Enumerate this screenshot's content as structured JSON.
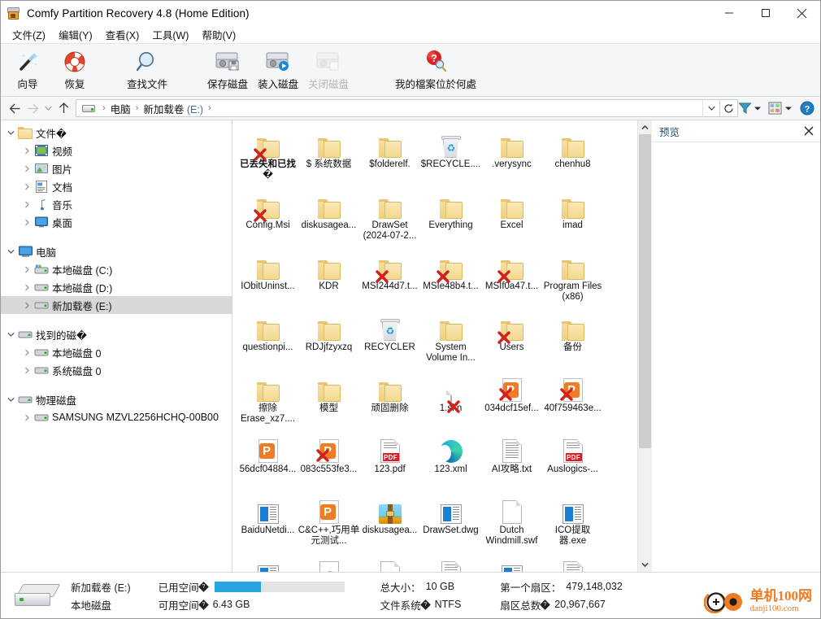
{
  "window": {
    "title": "Comfy Partition Recovery 4.8 (Home Edition)",
    "icon": "app-icon",
    "minimize": "—",
    "maximize": "☐",
    "close": "×"
  },
  "menubar": [
    {
      "label": "文件(Z)"
    },
    {
      "label": "编辑(Y)"
    },
    {
      "label": "查看(X)"
    },
    {
      "label": "工具(W)"
    },
    {
      "label": "帮助(V)"
    }
  ],
  "toolbar": [
    {
      "label": "向导",
      "icon": "wand-icon",
      "disabled": false
    },
    {
      "label": "恢复",
      "icon": "lifebuoy-icon",
      "disabled": false
    },
    {
      "label": "查找文件",
      "icon": "magnifier-icon",
      "disabled": false
    },
    {
      "label": "保存磁盘",
      "icon": "save-disk-icon",
      "disabled": false
    },
    {
      "label": "装入磁盘",
      "icon": "load-disk-icon",
      "disabled": false
    },
    {
      "label": "关闭磁盘",
      "icon": "close-disk-icon",
      "disabled": true
    },
    {
      "label": "我的檔案位於何處",
      "icon": "help-search-icon",
      "disabled": false
    }
  ],
  "addressbar": {
    "back": "←",
    "forward": "→",
    "history": "⌄",
    "up": "↑",
    "crumbs": [
      "电脑",
      "新加载卷 (E:)"
    ],
    "crumb_drive_suffix": "(E:)",
    "crumb_drive_name": "新加载卷",
    "dropdown": "⌄",
    "refresh": "↻",
    "filter_icon": "filter-icon",
    "view_icon": "view-mode-icon",
    "help_icon": "help-icon"
  },
  "tree": {
    "groups": [
      {
        "root": {
          "label": "文件�",
          "icon": "folder-icon",
          "expanded": true
        },
        "children": [
          {
            "label": "视频",
            "icon": "video-icon"
          },
          {
            "label": "图片",
            "icon": "pictures-icon"
          },
          {
            "label": "文档",
            "icon": "documents-icon"
          },
          {
            "label": "音乐",
            "icon": "music-icon"
          },
          {
            "label": "桌面",
            "icon": "desktop-icon"
          }
        ]
      },
      {
        "root": {
          "label": "电脑",
          "icon": "computer-icon",
          "expanded": true
        },
        "children": [
          {
            "label": "本地磁盘 (C:)",
            "icon": "system-drive-icon"
          },
          {
            "label": "本地磁盘 (D:)",
            "icon": "drive-icon"
          },
          {
            "label": "新加载卷 (E:)",
            "icon": "drive-icon",
            "selected": true
          }
        ]
      },
      {
        "root": {
          "label": "找到的磁�",
          "icon": "drive-icon",
          "expanded": true
        },
        "children": [
          {
            "label": "本地磁盘 0",
            "icon": "drive-icon"
          },
          {
            "label": "系统磁盘 0",
            "icon": "drive-icon"
          }
        ]
      },
      {
        "root": {
          "label": "物理磁盘",
          "icon": "drive-icon",
          "expanded": true
        },
        "children": [
          {
            "label": "SAMSUNG MZVL2256HCHQ-00B00",
            "icon": "drive-icon"
          }
        ]
      }
    ]
  },
  "files": [
    {
      "name": "已丢失和已找�",
      "icon": "folder-deleted-icon",
      "bold": true
    },
    {
      "name": "$ 系统数据",
      "icon": "folder-icon"
    },
    {
      "name": "$folderelf.",
      "icon": "folder-icon"
    },
    {
      "name": "$RECYCLE....",
      "icon": "recycle-bin-icon"
    },
    {
      "name": ".verysync",
      "icon": "folder-icon"
    },
    {
      "name": "chenhu8",
      "icon": "folder-icon"
    },
    {
      "name": "Config.Msi",
      "icon": "folder-deleted-icon"
    },
    {
      "name": "diskusagea...",
      "icon": "folder-icon"
    },
    {
      "name": "DrawSet (2024-07-2...",
      "icon": "folder-icon"
    },
    {
      "name": "Everything",
      "icon": "folder-icon"
    },
    {
      "name": "Excel",
      "icon": "folder-icon"
    },
    {
      "name": "imad",
      "icon": "folder-icon"
    },
    {
      "name": "IObitUninst...",
      "icon": "folder-icon"
    },
    {
      "name": "KDR",
      "icon": "folder-icon"
    },
    {
      "name": "MSI244d7.t...",
      "icon": "folder-deleted-icon"
    },
    {
      "name": "MSIe48b4.t...",
      "icon": "folder-deleted-icon"
    },
    {
      "name": "MSIf0a47.t...",
      "icon": "folder-deleted-icon"
    },
    {
      "name": "Program Files (x86)",
      "icon": "folder-icon"
    },
    {
      "name": "questionpi...",
      "icon": "folder-icon"
    },
    {
      "name": "RDJjfzyxzq",
      "icon": "folder-icon"
    },
    {
      "name": "RECYCLER",
      "icon": "recycle-bin-icon"
    },
    {
      "name": "System Volume In...",
      "icon": "folder-icon"
    },
    {
      "name": "Users",
      "icon": "folder-deleted-icon"
    },
    {
      "name": "备份",
      "icon": "folder-icon"
    },
    {
      "name": "擦除 Erase_xz7....",
      "icon": "folder-icon"
    },
    {
      "name": "模型",
      "icon": "folder-icon"
    },
    {
      "name": "顽固删除",
      "icon": "folder-icon"
    },
    {
      "name": "1.skn",
      "icon": "file-deleted-icon"
    },
    {
      "name": "034dcf15ef...",
      "icon": "ppt-deleted-icon"
    },
    {
      "name": "40f759463e...",
      "icon": "ppt-deleted-icon"
    },
    {
      "name": "56dcf04884...",
      "icon": "ppt-icon"
    },
    {
      "name": "083c553fe3...",
      "icon": "ppt-deleted-icon"
    },
    {
      "name": "123.pdf",
      "icon": "pdf-icon"
    },
    {
      "name": "123.xml",
      "icon": "edge-icon"
    },
    {
      "name": "AI攻略.txt",
      "icon": "text-icon"
    },
    {
      "name": "Auslogics-...",
      "icon": "pdf-icon"
    },
    {
      "name": "BaiduNetdi...",
      "icon": "exe-icon"
    },
    {
      "name": "C&C++,巧用单元测试...",
      "icon": "ppt-icon"
    },
    {
      "name": "diskusagea...",
      "icon": "zip-icon"
    },
    {
      "name": "DrawSet.dwg",
      "icon": "exe-icon"
    },
    {
      "name": "Dutch Windmill.swf",
      "icon": "blank-file-icon"
    },
    {
      "name": "ICO提取器.exe",
      "icon": "exe-icon"
    },
    {
      "name": "",
      "icon": "exe-icon"
    },
    {
      "name": "",
      "icon": "gear-file-icon"
    },
    {
      "name": "",
      "icon": "blank-file-icon"
    },
    {
      "name": "",
      "icon": "pdf-icon"
    },
    {
      "name": "",
      "icon": "exe-icon"
    },
    {
      "name": "",
      "icon": "pdf-icon"
    }
  ],
  "preview": {
    "title": "预览",
    "close": "×"
  },
  "statusbar": {
    "volume_name": "新加载卷 (E:)",
    "volume_type": "本地磁盘",
    "used_label": "已用空间",
    "used_percent": 36,
    "free_label": "可用空间",
    "free_value": "6.43 GB",
    "total_label": "总大小：",
    "total_value": "10 GB",
    "fs_label": "文件系统",
    "fs_value": "NTFS",
    "first_sector_label": "第一个扇区：",
    "first_sector_value": "479,148,032",
    "sector_total_label": "扇区总数",
    "sector_total_value": "20,967,667"
  },
  "watermark": {
    "cn": "单机100网",
    "en": "danji100.com",
    "color": "#f07b22"
  },
  "colors": {
    "accent": "#29a3e0",
    "folder": "#f3d98f",
    "selection": "#d8d8d8",
    "preview_title": "#1f4e79",
    "pdf_red": "#e01b24",
    "ppt_orange": "#f07b22"
  }
}
